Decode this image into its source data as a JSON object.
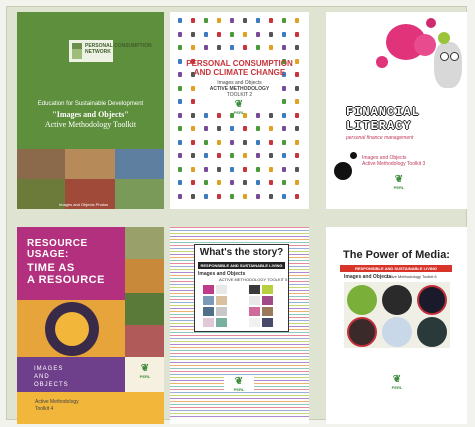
{
  "covers": [
    {
      "logo_text": "PERSONAL CONSUMPTION\nNETWORK",
      "subtitle": "Education for Sustainable Development",
      "title_line1": "\"Images and Objects\"",
      "title_line2": "Active Methodology Toolkit",
      "credit": "Images and Objects Photos"
    },
    {
      "title": "PERSONAL CONSUMPTION\nAND CLIMATE CHANGE",
      "sub1": "Images and Objects",
      "sub2": "ACTIVE METHODOLOGY",
      "sub3": "TOOLKIT 2",
      "logo": "PERL"
    },
    {
      "title_line1": "FINANCIAL",
      "title_line2": "LITERACY",
      "subtitle": "personal finance management",
      "sub2": "Images and Objects",
      "sub3": "Active Methodology Toolkit 3",
      "logo": "PERL"
    },
    {
      "title_line1": "RESOURCE",
      "title_line2": "USAGE:",
      "title_line3": "TIME AS",
      "title_line4": "A RESOURCE",
      "sub1": "IMAGES",
      "sub2": "AND",
      "sub3": "OBJECTS",
      "amt1": "Active Methodology",
      "amt2": "Toolkit 4",
      "logo": "PERL"
    },
    {
      "title": "What's the story?",
      "bar": "RESPONSIBLE AND SUSTAINABLE LIVING",
      "io": "Images and Objects",
      "amt": "ACTIVE METHODOLOGY TOOLKIT 5",
      "logo": "PERL"
    },
    {
      "title": "The Power of Media:",
      "bar": "RESPONSIBLE AND SUSTAINABLE LIVING",
      "io": "Images and Objects",
      "amt": "Active Methodology Toolkit 6",
      "logo": "PERL"
    }
  ],
  "colors": {
    "green": "#5e8f3c",
    "perl_green": "#3e8d3f",
    "red_title": "#c8343a",
    "magenta": "#b3307f",
    "purple": "#6e3f8a",
    "orange": "#f2b63a",
    "pink": "#e0337a"
  }
}
